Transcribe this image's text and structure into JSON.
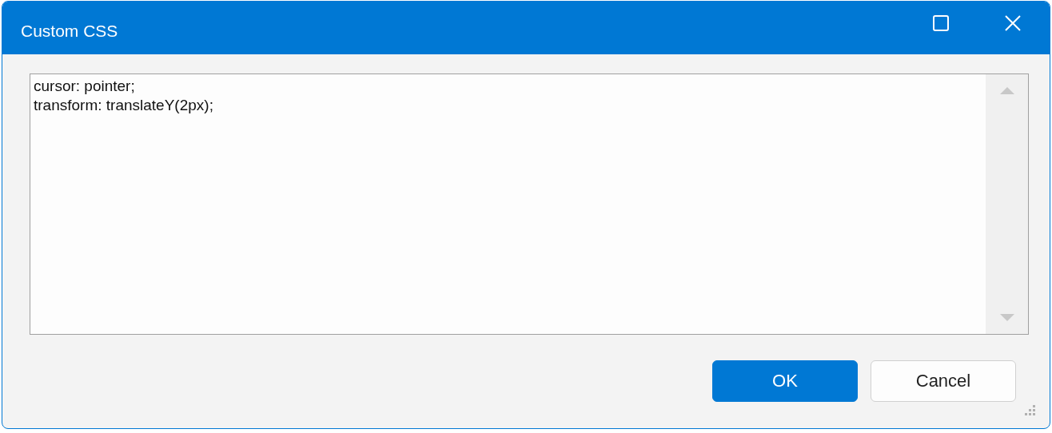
{
  "window": {
    "title": "Custom CSS"
  },
  "editor": {
    "value": "cursor: pointer;\ntransform: translateY(2px);"
  },
  "buttons": [
    {
      "label": "OK",
      "kind": "primary"
    },
    {
      "label": "Cancel",
      "kind": "secondary"
    }
  ]
}
